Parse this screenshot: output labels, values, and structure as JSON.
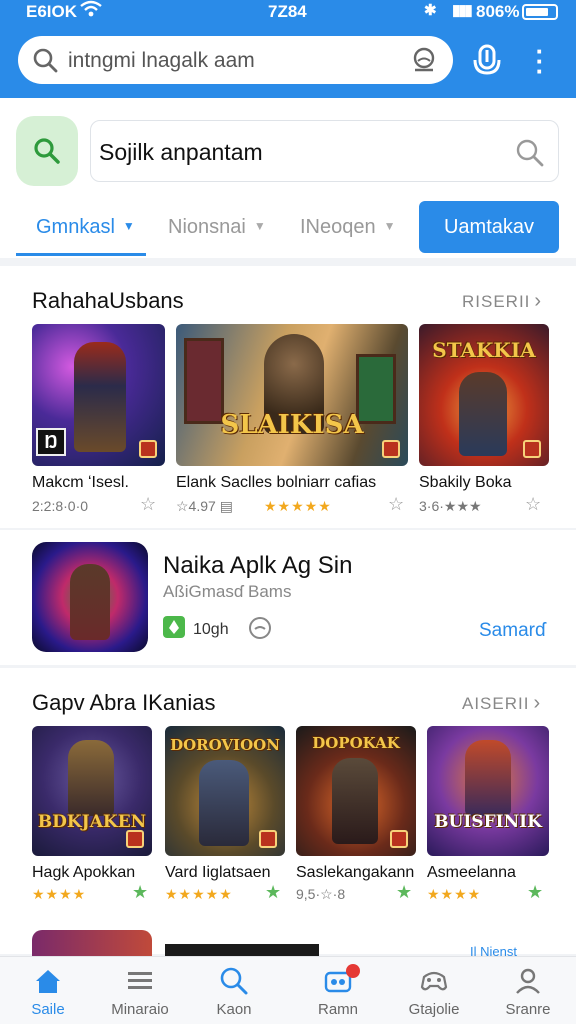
{
  "status": {
    "left": "E6IOK",
    "time": "7Z84",
    "battery": "806%"
  },
  "top_search": {
    "text": "intngmi lnagalk aam"
  },
  "secondary": {
    "search_text": "Sojilk anpantam",
    "cta": "Uamtakav"
  },
  "tabs": [
    {
      "label": "Gmnkasl"
    },
    {
      "label": "Nionsnai"
    },
    {
      "label": "INeoqen"
    }
  ],
  "section1": {
    "title": "RahahaUsbans",
    "more": "RISERII",
    "games": [
      {
        "name": "Makcm ʻIsesl.",
        "meta": "2:2:8·0·0",
        "icon": "star-outline-icon"
      },
      {
        "name": "Elank Saclles bolniarr cafias",
        "meta": "☆4.97 ▤",
        "stars": "★★★★★",
        "wordmark": "SLAIKISA"
      },
      {
        "name": "Sbakily Boka",
        "meta": "3·6·★★★",
        "wordmark": "STAKKIA"
      }
    ]
  },
  "featured": {
    "name": "Naika Aplk Ag Sin",
    "subtitle": "AßiGmasɗ Bams",
    "size": "10gh",
    "action": "Samarɗ"
  },
  "section3": {
    "title": "Gapv Abra IKanias",
    "more": "AISERII",
    "games": [
      {
        "name": "Hagk Apokkan",
        "stars": "★★★★",
        "wordmark": "BDKJAKEN"
      },
      {
        "name": "Vard Iiglatsaen",
        "stars": "★★★★★",
        "wordmark": "DOROVIOON"
      },
      {
        "name": "Saslekangakann",
        "meta": "9,5·☆·8",
        "wordmark": "DOPOKAK"
      },
      {
        "name": "Asmeelanna",
        "stars": "★★★★",
        "wordmark": "BUISFINIK"
      }
    ]
  },
  "peek": {
    "label": "Il Nienst"
  },
  "nav": [
    {
      "label": "Saile",
      "icon": "home-icon"
    },
    {
      "label": "Minaraio",
      "icon": "list-icon"
    },
    {
      "label": "Kaon",
      "icon": "search-icon"
    },
    {
      "label": "Ramn",
      "icon": "apps-icon"
    },
    {
      "label": "Gtajolie",
      "icon": "gamepad-icon"
    },
    {
      "label": "Sranre",
      "icon": "profile-icon"
    }
  ],
  "colors": {
    "primary": "#2a8be8",
    "star": "#f2a81e",
    "green": "#4cb84a"
  }
}
